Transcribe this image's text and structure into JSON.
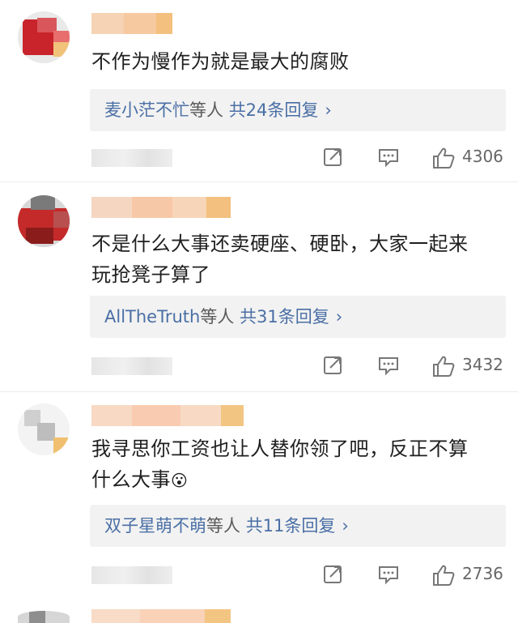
{
  "comments": [
    {
      "text_lines": [
        "不作为慢作为就是最大的腐败"
      ],
      "reply_user": "麦小茫不忙",
      "reply_suffix": "等人",
      "reply_count": "共24条回复",
      "chevron": "›",
      "likes": "4306"
    },
    {
      "text_lines": [
        "不是什么大事还卖硬座、硬卧，大家一起来",
        "玩抢凳子算了"
      ],
      "reply_user": "AllTheTruth",
      "reply_suffix": "等人",
      "reply_count": "共31条回复",
      "chevron": "›",
      "likes": "3432"
    },
    {
      "text_lines": [
        "我寻思你工资也让人替你领了吧，反正不算",
        "什么大事"
      ],
      "emoji": "😮",
      "reply_user": "双子星萌不萌",
      "reply_suffix": "等人",
      "reply_count": "共11条回复",
      "chevron": "›",
      "likes": "2736"
    }
  ],
  "icons": {
    "repost": "repost-icon",
    "comment": "comment-icon",
    "like": "thumbs-up-icon"
  },
  "colors": {
    "link": "#4a6fa5",
    "reply_bg": "#f2f2f2"
  }
}
